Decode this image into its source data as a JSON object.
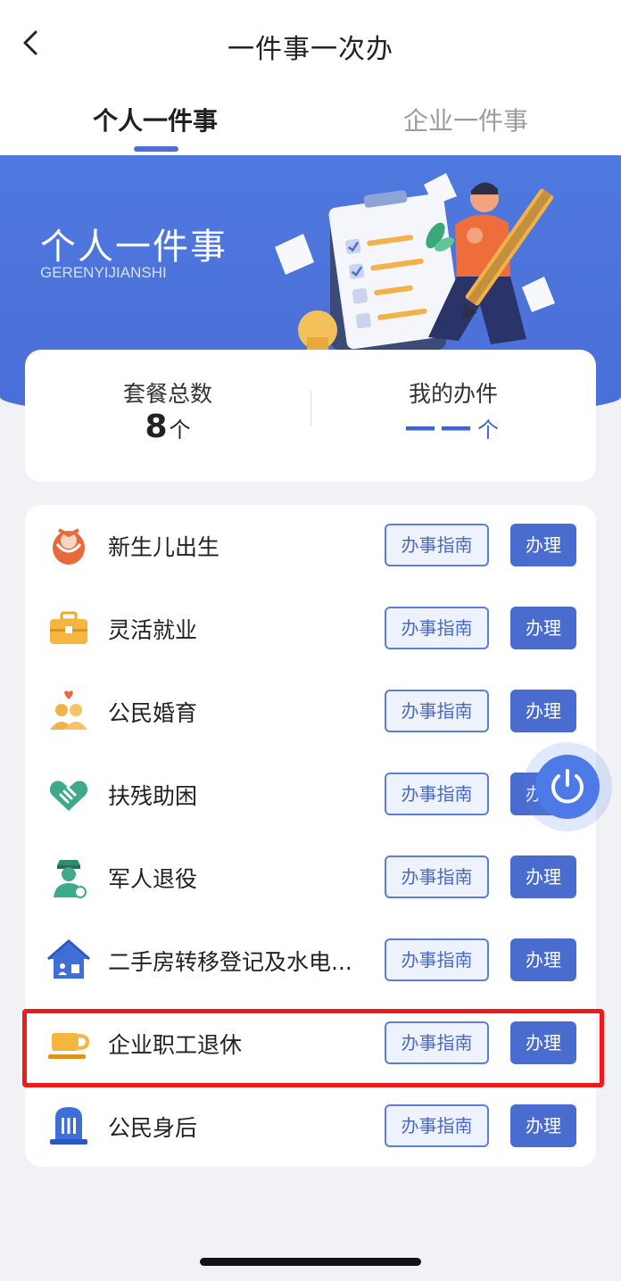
{
  "header": {
    "title": "一件事一次办",
    "back_icon": "chevron-left-icon"
  },
  "tabs": [
    {
      "label": "个人一件事",
      "active": true
    },
    {
      "label": "企业一件事",
      "active": false
    }
  ],
  "banner": {
    "title": "个人一件事",
    "subtitle": "GERENYIJIANSHI"
  },
  "stats": {
    "package_total_label": "套餐总数",
    "package_total_value": "8",
    "package_total_unit": "个",
    "my_cases_label": "我的办件",
    "my_cases_value": "——",
    "my_cases_unit": "个"
  },
  "items": [
    {
      "label": "新生儿出生",
      "icon": "baby-icon",
      "guide": "办事指南",
      "action": "办理"
    },
    {
      "label": "灵活就业",
      "icon": "briefcase-icon",
      "guide": "办事指南",
      "action": "办理"
    },
    {
      "label": "公民婚育",
      "icon": "couple-icon",
      "guide": "办事指南",
      "action": "办理"
    },
    {
      "label": "扶残助困",
      "icon": "handshake-icon",
      "guide": "办事指南",
      "action": "办理"
    },
    {
      "label": "军人退役",
      "icon": "soldier-icon",
      "guide": "办事指南",
      "action": "办理"
    },
    {
      "label": "二手房转移登记及水电...",
      "icon": "house-icon",
      "guide": "办事指南",
      "action": "办理"
    },
    {
      "label": "企业职工退休",
      "icon": "teacup-icon",
      "guide": "办事指南",
      "action": "办理"
    },
    {
      "label": "公民身后",
      "icon": "memorial-icon",
      "guide": "办事指南",
      "action": "办理"
    }
  ],
  "colors": {
    "accent": "#4b6ccf",
    "banner": "#4f79de",
    "highlight": "#ef1b1b"
  },
  "floating_button_icon": "power-icon"
}
